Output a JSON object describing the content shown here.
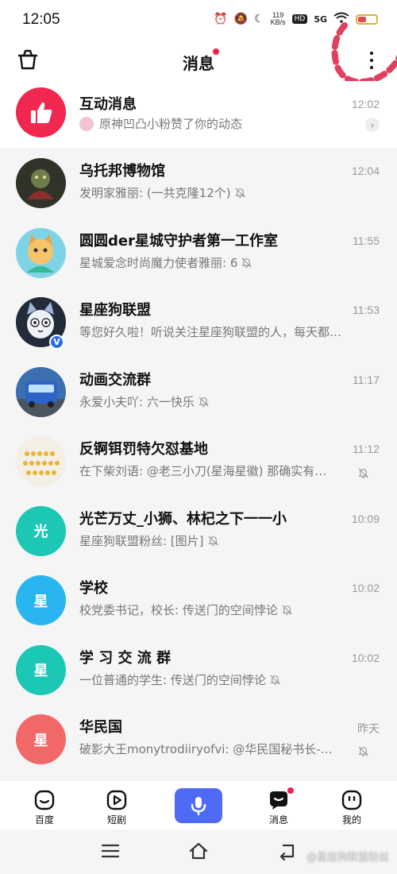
{
  "status_bar": {
    "time": "12:05",
    "net_speed_value": "119",
    "net_speed_unit": "KB/s",
    "hd_label": "HD",
    "signal_label": "5G"
  },
  "header": {
    "title": "消息",
    "has_dot": true
  },
  "conversations": [
    {
      "title": "互动消息",
      "time": "12:02",
      "subtitle": "原神凹凸小粉赞了你的动态",
      "avatar_color": "#f0284f",
      "muted": false
    },
    {
      "title": "乌托邦博物馆",
      "time": "12:04",
      "subtitle": "发明家雅丽: (一共克隆12个)",
      "avatar_color": "#2f3328",
      "muted": true
    },
    {
      "title": "圆圆der星城守护者第一工作室",
      "time": "11:55",
      "subtitle": "星城爱念时尚魔力使者雅丽: 6",
      "avatar_color": "#7fd3e6",
      "muted": true
    },
    {
      "title": "星座狗联盟",
      "time": "11:53",
      "subtitle": "等您好久啦！听说关注星座狗联盟的人，每天都…",
      "avatar_color": "#222b3a",
      "muted": false
    },
    {
      "title": "动画交流群",
      "time": "11:17",
      "subtitle": "永爱小夫吖: 六一快乐",
      "avatar_color": "#3b6fb0",
      "muted": true
    },
    {
      "title": "反锕铒罚特欠怼基地",
      "time": "11:12",
      "subtitle": "在下柴刘语: @老三小刀(星海星徽) 那确实有…",
      "avatar_color": "#f3efe5",
      "muted": true
    },
    {
      "title": "光芒万丈_小狮、林杞之下一一小",
      "time": "10:09",
      "subtitle": "星座狗联盟粉丝: [图片]",
      "avatar_color": "#1cc7b5",
      "avatar_text": "光",
      "muted": true
    },
    {
      "title": "学校",
      "time": "10:02",
      "subtitle": "校党委书记，校长: 传送门的空间悖论",
      "avatar_color": "#29b6f0",
      "avatar_text": "星",
      "muted": true
    },
    {
      "title": "学 习 交 流 群",
      "time": "10:02",
      "subtitle": "一位普通的学生: 传送门的空间悖论",
      "avatar_color": "#1cc7b5",
      "avatar_text": "星",
      "muted": true
    },
    {
      "title": "华民国",
      "time": "昨天",
      "subtitle": "破影大王monytrodiiryofvi: @华民国秘书长-…",
      "avatar_color": "#f26868",
      "avatar_text": "星",
      "muted": true
    }
  ],
  "tabbar": {
    "tabs": [
      {
        "label": "百度",
        "icon": "baidu-face-icon"
      },
      {
        "label": "短剧",
        "icon": "play-square-icon"
      },
      {
        "label": "",
        "icon": "microphone-icon"
      },
      {
        "label": "消息",
        "icon": "message-face-icon",
        "badge": true
      },
      {
        "label": "我的",
        "icon": "profile-face-icon"
      }
    ]
  },
  "watermark": "@星座狗联盟粉丝",
  "colors": {
    "accent": "#4f6bf6",
    "badge": "#f01f4c",
    "annotation": "#e0405e"
  }
}
